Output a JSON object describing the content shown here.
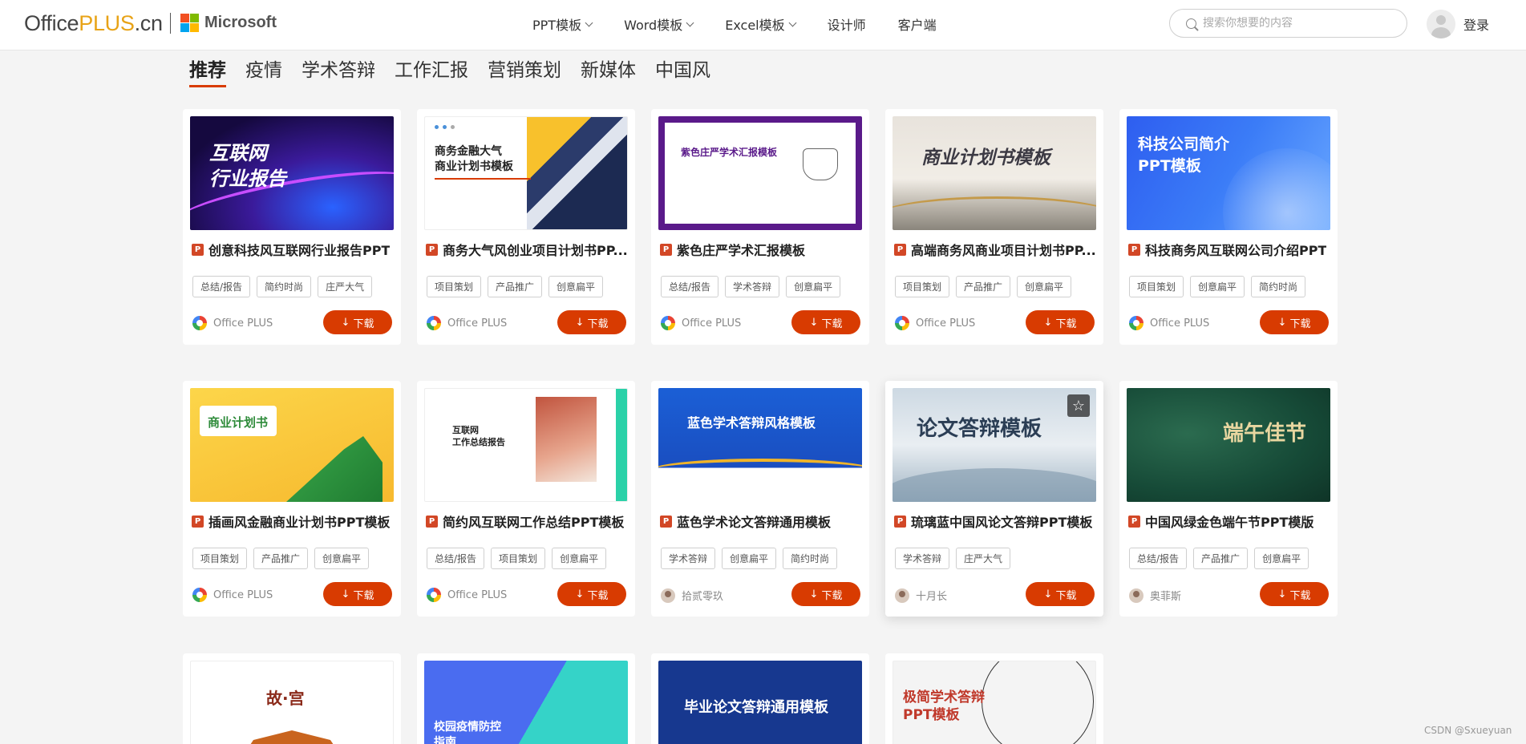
{
  "header": {
    "logo_office": "Office",
    "logo_plus": "PLUS",
    "logo_cn": ".cn",
    "ms_label": "Microsoft",
    "ms_colors": [
      "#f25022",
      "#7fba00",
      "#00a4ef",
      "#ffb900"
    ],
    "nav": [
      {
        "label": "PPT模板",
        "dropdown": true
      },
      {
        "label": "Word模板",
        "dropdown": true
      },
      {
        "label": "Excel模板",
        "dropdown": true
      },
      {
        "label": "设计师",
        "dropdown": false
      },
      {
        "label": "客户端",
        "dropdown": false
      }
    ],
    "search_placeholder": "搜索你想要的内容",
    "login": "登录"
  },
  "tabs": [
    {
      "label": "推荐",
      "active": true
    },
    {
      "label": "疫情"
    },
    {
      "label": "学术答辩"
    },
    {
      "label": "工作汇报"
    },
    {
      "label": "营销策划"
    },
    {
      "label": "新媒体"
    },
    {
      "label": "中国风"
    }
  ],
  "download_label": "下载",
  "cards": [
    {
      "title": "创意科技风互联网行业报告PPT",
      "tags": [
        "总结/报告",
        "简约时尚",
        "庄严大气"
      ],
      "author": "Office PLUS",
      "thumb_text": "互联网\n行业报告"
    },
    {
      "title": "商务大气风创业项目计划书PP...",
      "tags": [
        "项目策划",
        "产品推广",
        "创意扁平"
      ],
      "author": "Office PLUS",
      "thumb_text": "商务金融大气\n商业计划书模板"
    },
    {
      "title": "紫色庄严学术汇报模板",
      "tags": [
        "总结/报告",
        "学术答辩",
        "创意扁平"
      ],
      "author": "Office PLUS",
      "thumb_text": "紫色庄严学术汇报模板"
    },
    {
      "title": "高端商务风商业项目计划书PP...",
      "tags": [
        "项目策划",
        "产品推广",
        "创意扁平"
      ],
      "author": "Office PLUS",
      "thumb_text": "商业计划书模板"
    },
    {
      "title": "科技商务风互联网公司介绍PPT",
      "tags": [
        "项目策划",
        "创意扁平",
        "简约时尚"
      ],
      "author": "Office PLUS",
      "thumb_text": "科技公司简介\nPPT模板"
    },
    {
      "title": "插画风金融商业计划书PPT模板",
      "tags": [
        "项目策划",
        "产品推广",
        "创意扁平"
      ],
      "author": "Office PLUS",
      "thumb_text": "商业计划书"
    },
    {
      "title": "简约风互联网工作总结PPT模板",
      "tags": [
        "总结/报告",
        "项目策划",
        "创意扁平"
      ],
      "author": "Office PLUS",
      "thumb_text": "互联网\n工作总结报告"
    },
    {
      "title": "蓝色学术论文答辩通用模板",
      "tags": [
        "学术答辩",
        "创意扁平",
        "简约时尚"
      ],
      "author": "拾贰零玖",
      "thumb_text": "蓝色学术答辩风格模板"
    },
    {
      "title": "琉璃蓝中国风论文答辩PPT模板",
      "tags": [
        "学术答辩",
        "庄严大气"
      ],
      "author": "十月长",
      "thumb_text": "论文答辩模板"
    },
    {
      "title": "中国风绿金色端午节PPT模版",
      "tags": [
        "总结/报告",
        "产品推广",
        "创意扁平"
      ],
      "author": "奥菲斯",
      "thumb_text": "端午佳节"
    }
  ],
  "partial_cards": [
    {
      "thumb_text": "故·宫"
    },
    {
      "thumb_text": "校园疫情防控\n指南"
    },
    {
      "thumb_text": "毕业论文答辩通用模板"
    },
    {
      "thumb_text": "极简学术答辩\nPPT模板"
    }
  ],
  "watermark": "CSDN @Sxueyuan"
}
